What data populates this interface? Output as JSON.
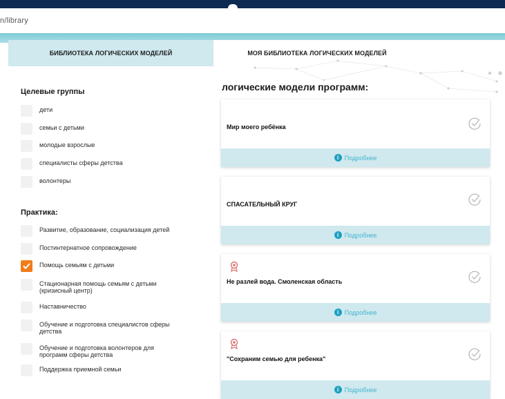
{
  "browser": {
    "url": "n/library"
  },
  "tabs": {
    "left": "БИБЛИОТЕКА ЛОГИЧЕСКИХ МОДЕЛЕЙ",
    "right": "МОЯ БИБЛИОТЕКА ЛОГИЧЕСКИХ МОДЕЛЕЙ"
  },
  "filters": {
    "target_groups": {
      "title": "Целевые группы",
      "items": [
        {
          "label": "дети",
          "checked": false
        },
        {
          "label": "семьи с детьми",
          "checked": false
        },
        {
          "label": "молодые взрослые",
          "checked": false
        },
        {
          "label": "специалисты сферы детства",
          "checked": false
        },
        {
          "label": "волонтеры",
          "checked": false
        }
      ]
    },
    "practice": {
      "title": "Практика:",
      "items": [
        {
          "label": "Развитие, образование, социализация детей",
          "checked": false
        },
        {
          "label": "Постинтернатное сопровождение",
          "checked": false
        },
        {
          "label": "Помощь семьям с детьми",
          "checked": true
        },
        {
          "label": "Стационарная помощь семьям с детьми (кризисный центр)",
          "checked": false
        },
        {
          "label": "Наставничество",
          "checked": false
        },
        {
          "label": "Обучение и подготовка специалистов сферы детства",
          "checked": false
        },
        {
          "label": "Обучение и подготовка волонтеров для программ сферы детства",
          "checked": false
        },
        {
          "label": "Поддержка приемной семьи",
          "checked": false
        }
      ]
    }
  },
  "main": {
    "title": "логические модели программ:",
    "more_label": "Подробнее",
    "cards": [
      {
        "title": "Мир моего ребёнка",
        "award": false
      },
      {
        "title": "СПАСАТЕЛЬНЫЙ КРУГ",
        "award": false
      },
      {
        "title": "Не разлей вода. Смоленская область",
        "award": true
      },
      {
        "title": "\"Сохраним семью для ребенка\"",
        "award": true
      }
    ]
  },
  "colors": {
    "accent": "#f07d1a",
    "tab_bg": "#cfe9ee",
    "link": "#46b4cf",
    "header": "#0d2a52"
  }
}
